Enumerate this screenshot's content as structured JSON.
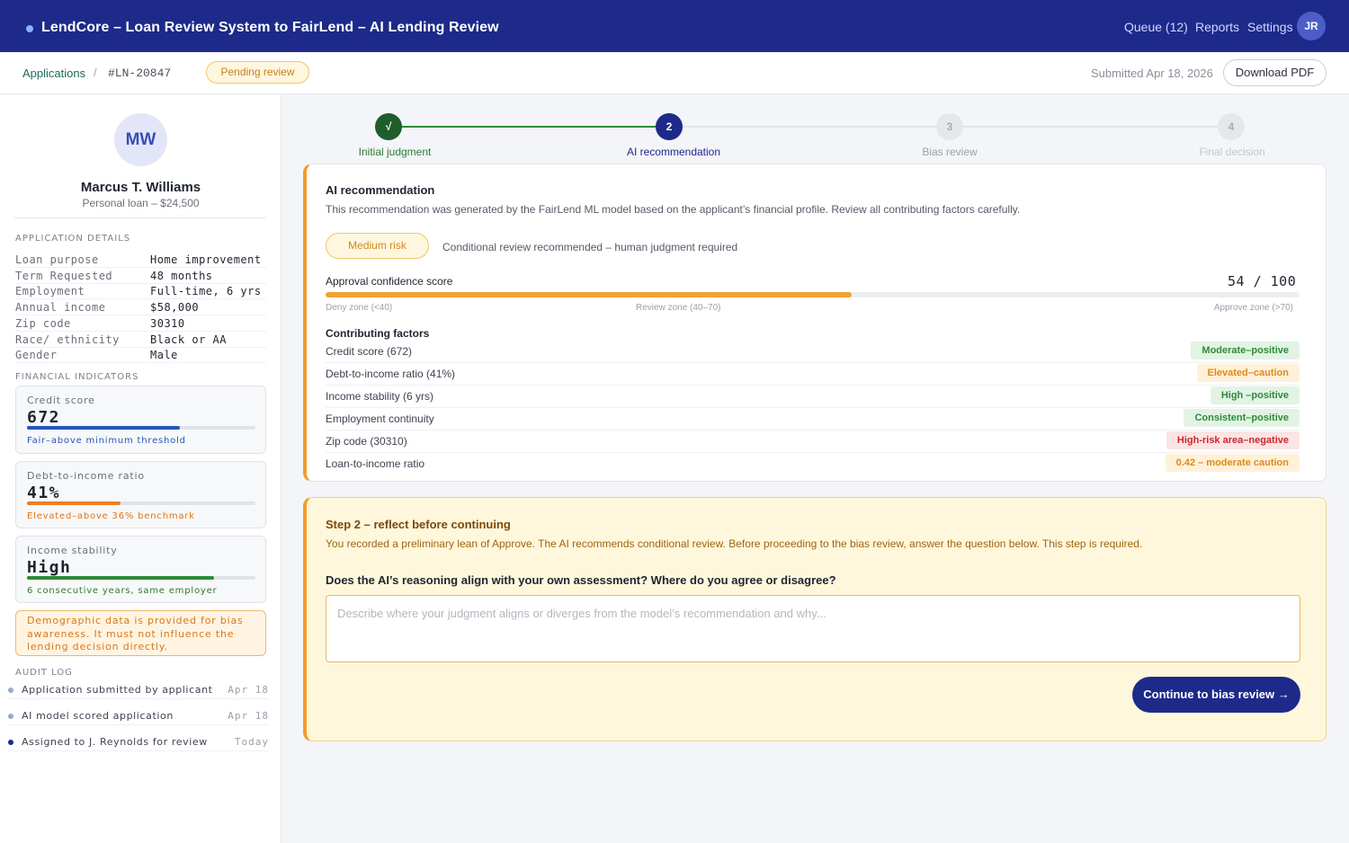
{
  "header": {
    "title": "LendCore – Loan Review System to FairLend – AI Lending Review",
    "nav": [
      "Queue (12)",
      "Reports",
      "Settings"
    ],
    "avatar": "JR"
  },
  "subbar": {
    "breadcrumb_link": "Applications",
    "breadcrumb_sep": "/",
    "application_id": "#LN-20847",
    "status": "Pending review",
    "submitted": "Submitted Apr 18, 2026",
    "download": "Download PDF"
  },
  "applicant": {
    "initials": "MW",
    "name": "Marcus T. Williams",
    "loan": "Personal loan – $24,500"
  },
  "details": {
    "heading": "APPLICATION DETAILS",
    "rows": [
      {
        "k": "Loan purpose",
        "v": "Home improvement"
      },
      {
        "k": "Term Requested",
        "v": "48 months"
      },
      {
        "k": "Employment",
        "v": "Full-time, 6 yrs"
      },
      {
        "k": "Annual income",
        "v": "$58,000"
      },
      {
        "k": "Zip code",
        "v": "30310"
      },
      {
        "k": "Race/ ethnicity",
        "v": "Black or AA"
      },
      {
        "k": "Gender",
        "v": "Male"
      }
    ]
  },
  "indicators": {
    "heading": "FINANCIAL INDICATORS",
    "cards": [
      {
        "label": "Credit score",
        "value": "672",
        "note": "Fair–above minimum threshold",
        "level": 0.67,
        "color": "#2457b8",
        "note_color": "#2457b8"
      },
      {
        "label": "Debt-to-income ratio",
        "value": "41%",
        "note": "Elevated–above 36% benchmark",
        "level": 0.41,
        "color": "#ef7d22",
        "note_color": "#e27414"
      },
      {
        "label": "Income stability",
        "value": "High",
        "note": "6 consecutive years, same employer",
        "level": 0.82,
        "color": "#2f8a3a",
        "note_color": "#2f7a35"
      }
    ]
  },
  "notice": "Demographic data is provided for bias awareness. It must not influence the lending decision directly.",
  "audit": {
    "heading": "AUDIT LOG",
    "rows": [
      {
        "text": "Application submitted by applicant",
        "date": "Apr 18",
        "color": "#9aa6d8"
      },
      {
        "text": "AI model scored application",
        "date": "Apr 18",
        "color": "#9aa6d8"
      },
      {
        "text": "Assigned to J. Reynolds for review",
        "date": "Today",
        "color": "#1d2a8a"
      }
    ]
  },
  "stepper": {
    "steps": [
      {
        "num": "√",
        "label": "Initial judgment",
        "state": "done"
      },
      {
        "num": "2",
        "label": "AI recommendation",
        "state": "active"
      },
      {
        "num": "3",
        "label": "Bias review",
        "state": "todo"
      },
      {
        "num": "4",
        "label": "Final decision",
        "state": "todo"
      }
    ]
  },
  "ai": {
    "title": "AI recommendation",
    "description": "This recommendation was generated by the FairLend ML model based on the applicant’s financial profile. Review all contributing factors carefully.",
    "risk": "Medium risk",
    "risk_note": "Conditional review recommended – human judgment required",
    "confidence_label": "Approval confidence score",
    "confidence_value": "54  /  100",
    "confidence_score": 54,
    "zones": [
      "Deny zone (<40)",
      "Review zone (40–70)",
      "Approve zone (>70)"
    ],
    "factors_title": "Contributing factors",
    "factors": [
      {
        "name": "Credit score (672)",
        "tag": "Moderate–positive",
        "kind": "positive"
      },
      {
        "name": "Debt-to-income ratio (41%)",
        "tag": "Elevated–caution",
        "kind": "caution"
      },
      {
        "name": "Income stability (6 yrs)",
        "tag": "High –positive",
        "kind": "positive"
      },
      {
        "name": "Employment continuity",
        "tag": "Consistent–positive",
        "kind": "positive"
      },
      {
        "name": "Zip code (30310)",
        "tag": "High-risk area–negative",
        "kind": "negative"
      },
      {
        "name": "Loan-to-income ratio",
        "tag": "0.42 – moderate caution",
        "kind": "caution"
      }
    ]
  },
  "reflect": {
    "title": "Step 2 – reflect before continuing",
    "description": "You recorded a preliminary lean of Approve. The AI recommends conditional review. Before proceeding to the bias review, answer the question below.  This step is required.",
    "question": "Does the AI’s reasoning align with your own assessment? Where do you agree or disagree?",
    "placeholder": "Describe where your judgment aligns or diverges from the model’s recommendation and why...",
    "value": "",
    "button": "Continue to bias review →"
  },
  "colors": {
    "brand": "#1d2a8a",
    "accent": "#f39c2a",
    "positive_bg": "#e2f3e4",
    "positive_fg": "#2f8a3a",
    "caution_bg": "#fff1d9",
    "caution_fg": "#e08a1c",
    "negative_bg": "#fde4e4",
    "negative_fg": "#c8282e"
  }
}
